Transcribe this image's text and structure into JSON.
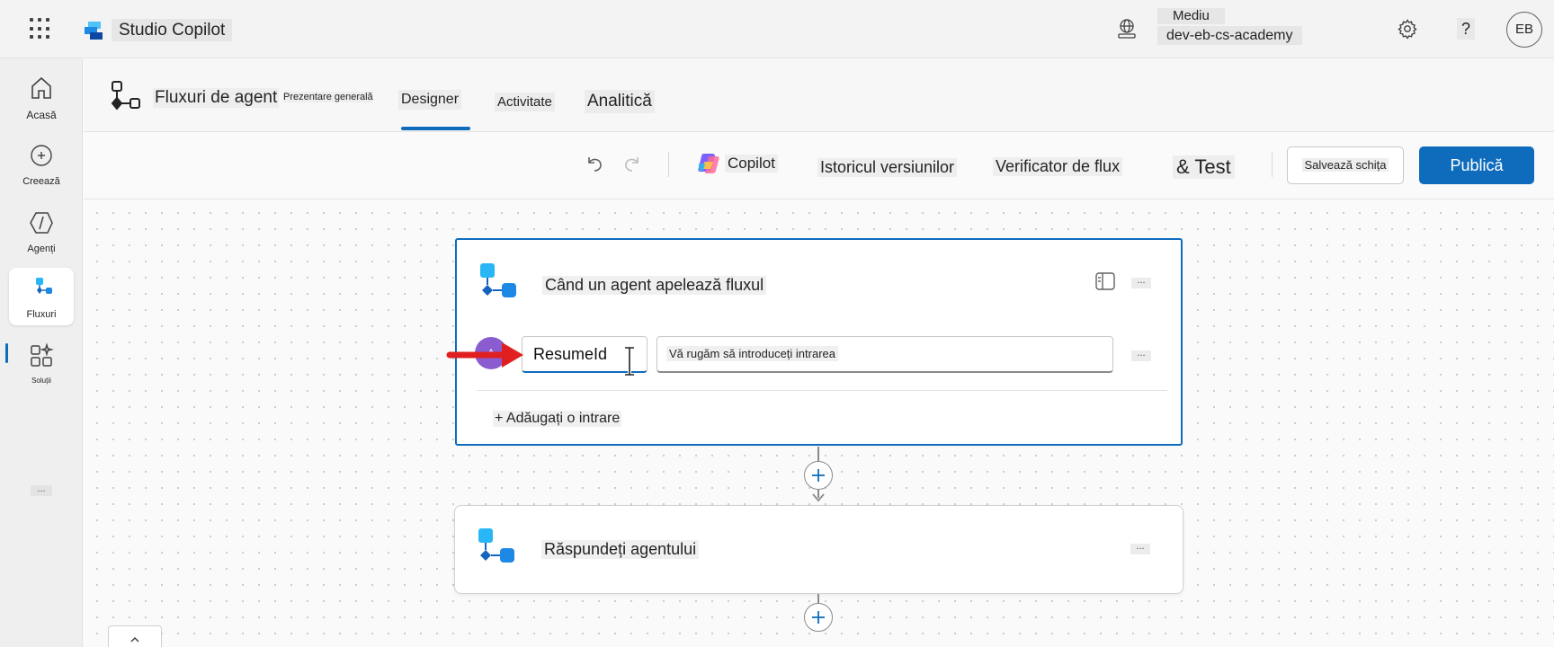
{
  "topbar": {
    "app_title": "Studio Copilot",
    "environment_label": "Mediu",
    "environment_value": "dev-eb-cs-academy",
    "help_label": "?",
    "user_initials": "EB"
  },
  "leftnav": {
    "items": [
      {
        "label": "Acasă",
        "icon": "home-icon"
      },
      {
        "label": "Creează",
        "icon": "plus-circle-icon"
      },
      {
        "label": "Agenți",
        "icon": "agents-icon"
      },
      {
        "label": "Fluxuri",
        "icon": "flows-icon",
        "active": true
      },
      {
        "label": "Soluții",
        "icon": "apps-sparkle-icon"
      }
    ],
    "more_label": "..."
  },
  "header": {
    "title": "Fluxuri de agent",
    "overview": "Prezentare generală",
    "tabs": [
      {
        "label": "Designer",
        "selected": true
      },
      {
        "label": "Activitate"
      },
      {
        "label": "Analitică"
      }
    ]
  },
  "commandbar": {
    "copilot_label": "Copilot",
    "version_history_label": "Istoricul versiunilor",
    "flow_checker_label": "Verificator de flux",
    "test_label": "& Test",
    "save_draft_label": "Salvează schița",
    "publish_label": "Publică"
  },
  "canvas": {
    "trigger_card": {
      "title": "Când un agent apelează fluxul",
      "more_label": "...",
      "input": {
        "avatar_letter": "A",
        "name_value": "ResumeId",
        "value_placeholder": "Vă rugăm să introduceți intrarea",
        "more_label": "..."
      },
      "add_input_label": "+ Adăugați o intrare"
    },
    "respond_card": {
      "title": "Răspundeți agentului",
      "more_label": "..."
    }
  },
  "colors": {
    "accent": "#0f6cbd",
    "annotation_arrow": "#e02020",
    "input_avatar": "#8a5cd0"
  }
}
